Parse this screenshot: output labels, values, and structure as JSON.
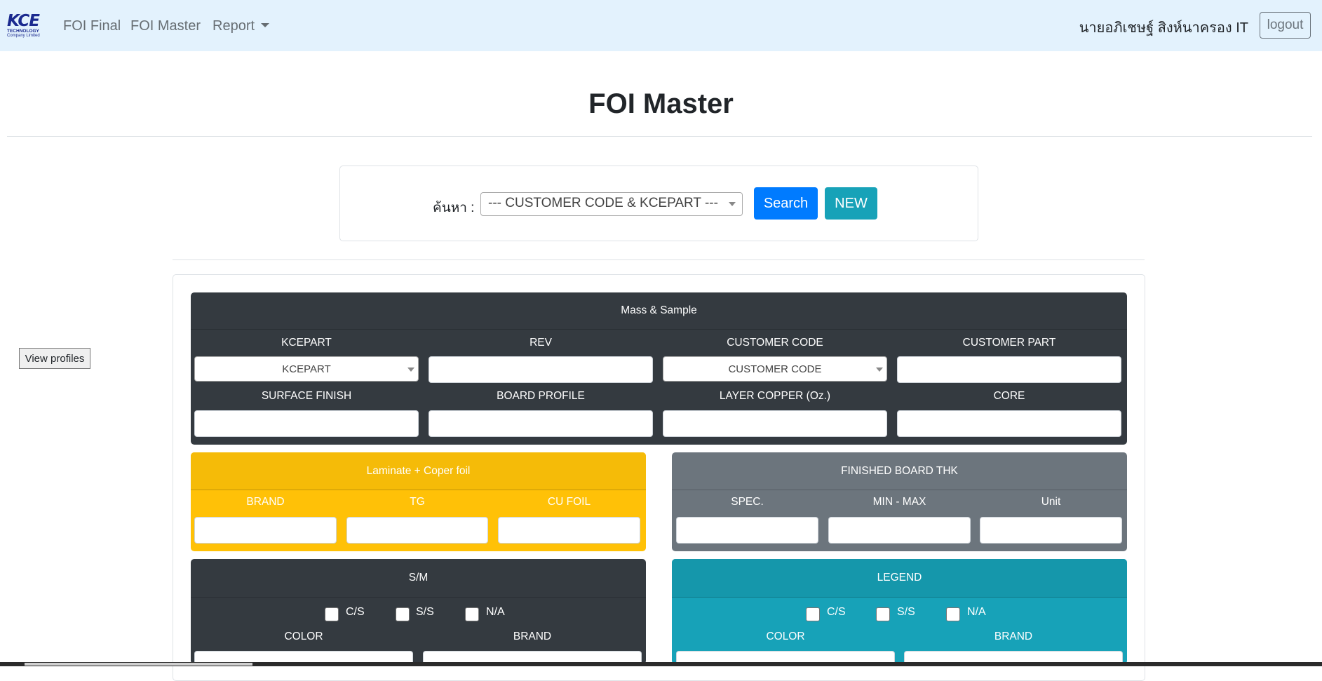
{
  "navbar": {
    "logo": {
      "main": "KCE",
      "line1": "TECHNOLOGY",
      "line2": "Company Limited"
    },
    "links": [
      "FOI Final",
      "FOI Master",
      "Report"
    ],
    "user": "นายอภิเชษฐ์ สิงห์นาครอง IT",
    "logout": "logout"
  },
  "page": {
    "title": "FOI Master"
  },
  "search": {
    "label": "ค้นหา :",
    "select_value": "--- CUSTOMER CODE & KCEPART ---",
    "search_button": "Search",
    "new_button": "NEW"
  },
  "sidebar": {
    "view_profiles": "View profiles"
  },
  "mass_sample": {
    "title": "Mass & Sample",
    "labels": [
      "KCEPART",
      "REV",
      "CUSTOMER CODE",
      "CUSTOMER PART",
      "SURFACE FINISH",
      "BOARD PROFILE",
      "LAYER COPPER (Oz.)",
      "CORE"
    ],
    "kcepart_select": "KCEPART",
    "customer_code_select": "CUSTOMER CODE"
  },
  "laminate": {
    "title": "Laminate + Coper foil",
    "labels": [
      "BRAND",
      "TG",
      "CU FOIL"
    ]
  },
  "finished": {
    "title": "FINISHED BOARD THK",
    "labels": [
      "SPEC.",
      "MIN - MAX",
      "Unit"
    ]
  },
  "sm": {
    "title": "S/M",
    "checks": [
      "C/S",
      "S/S",
      "N/A"
    ],
    "labels": [
      "COLOR",
      "BRAND"
    ]
  },
  "legend": {
    "title": "LEGEND",
    "checks": [
      "C/S",
      "S/S",
      "N/A"
    ],
    "labels": [
      "COLOR",
      "BRAND"
    ]
  },
  "colors": {
    "primary": "#007bff",
    "info": "#17a2b8",
    "warning": "#ffc107",
    "dark": "#343a40",
    "secondary": "#6c757d",
    "navbar": "#e3f2fd"
  }
}
